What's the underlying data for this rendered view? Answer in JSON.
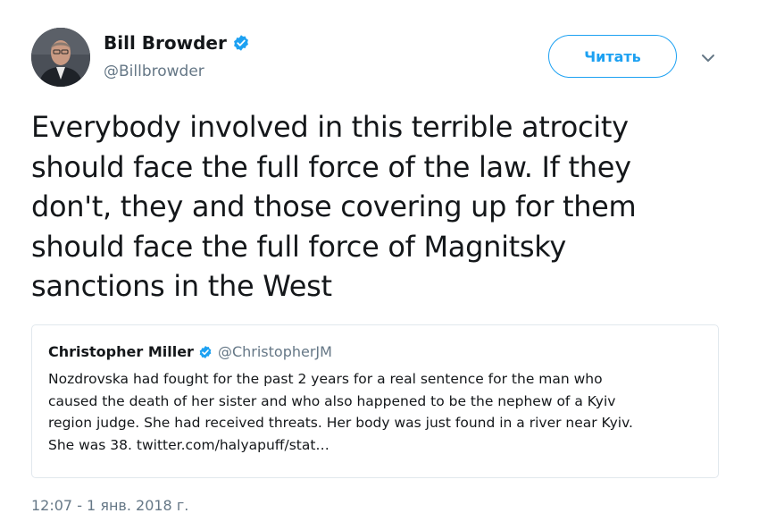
{
  "author": {
    "name": "Bill Browder",
    "handle": "@Billbrowder",
    "verified_icon": "verified-badge-icon"
  },
  "follow_button": {
    "label": "Читать"
  },
  "menu": {
    "icon": "chevron-down-icon"
  },
  "tweet": {
    "lines": [
      "Everybody involved in this terrible atrocity",
      "should face the full force of the law. If they",
      "don't, they and those covering up for them",
      "should face the full force of Magnitsky",
      "sanctions in the West"
    ]
  },
  "quoted_tweet": {
    "author_name": "Christopher Miller",
    "author_handle": "@ChristopherJM",
    "lines": [
      "Nozdrovska had fought for the past 2 years for a real sentence for the man who",
      "caused the death of her sister and who also happened to be the nephew of a Kyiv",
      "region judge. She had received threats. Her body was just found in a river near Kyiv.",
      "She was 38. twitter.com/halyapuff/stat…"
    ]
  },
  "timestamp": "12:07 - 1 янв. 2018 г.",
  "colors": {
    "accent": "#1da1f2",
    "text": "#14171a",
    "secondary": "#657786",
    "border": "#e1e8ed"
  }
}
